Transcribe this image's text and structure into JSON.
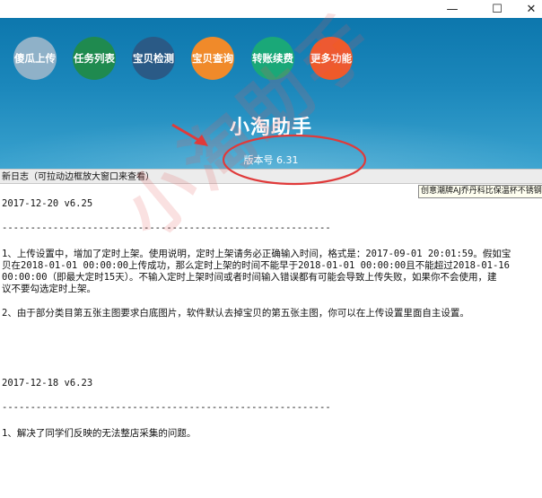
{
  "window": {
    "controls": {
      "minimize": "—",
      "maximize": "☐",
      "close": "✕"
    }
  },
  "toolbar": {
    "buttons": [
      {
        "label": "傻瓜上传",
        "color": "#8fb1c8"
      },
      {
        "label": "任务列表",
        "color": "#1f8a4f"
      },
      {
        "label": "宝贝检测",
        "color": "#2a5a86"
      },
      {
        "label": "宝贝查询",
        "color": "#f08a2a"
      },
      {
        "label": "转账续费",
        "color": "#1aa878"
      },
      {
        "label": "更多功能",
        "color": "#ef5a2a"
      }
    ]
  },
  "header": {
    "title": "小淘助手",
    "version": "版本号 6.31"
  },
  "log": {
    "title": "新日志（可拉动边框放大窗口来查看）",
    "tooltip": "创意潮牌AJ乔丹科比保温杯不锈钢保",
    "lines": [
      "2017-12-20 v6.25",
      "----------------------------------------------------------",
      "1、上传设置中，增加了定时上架。使用说明，定时上架请务必正确输入时间，格式是：2017-09-01 20:01:59。假如宝",
      "贝在2018-01-01 00:00:00上传成功，那么定时上架的时间不能早于2018-01-01 00:00:00且不能超过2018-01-16",
      "00:00:00（即最大定时15天）。不输入定时上架时间或者时间输入错误都有可能会导致上传失败，如果你不会使用，建",
      "议不要勾选定时上架。",
      "2、由于部分类目第五张主图要求白底图片，软件默认去掉宝贝的第五张主图，你可以在上传设置里面自主设置。",
      "2017-12-18 v6.23",
      "----------------------------------------------------------",
      "1、解决了同学们反映的无法整店采集的问题。"
    ]
  },
  "watermark": "小淘助手",
  "colors": {
    "header_top": "#0d77ad",
    "header_bottom": "#3aa3cf",
    "annotation": "#e03a3a"
  }
}
